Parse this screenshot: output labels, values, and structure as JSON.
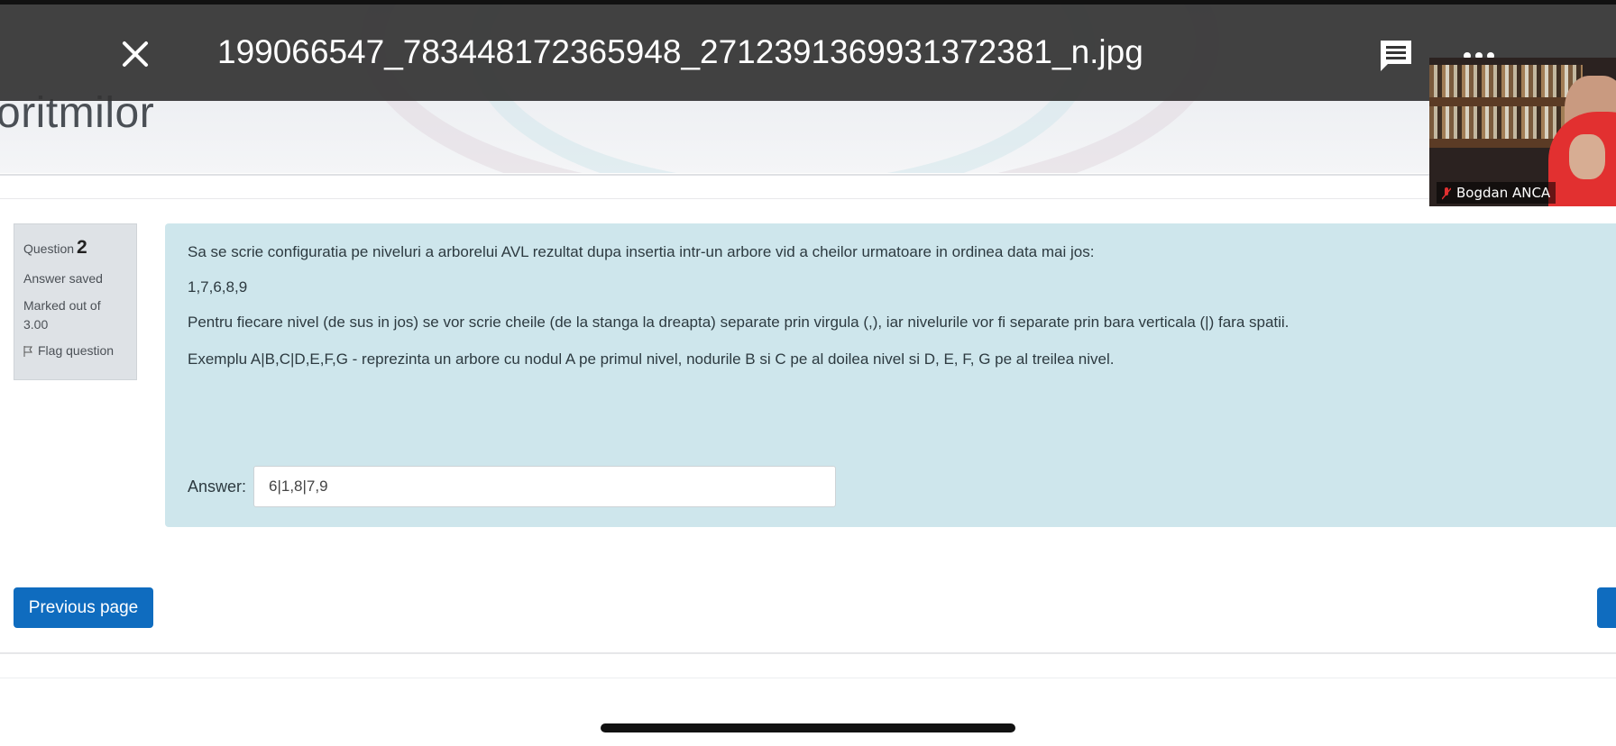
{
  "page": {
    "title_fragment": "oritmilor"
  },
  "viewer": {
    "file_name": "199066547_783448172365948_2712391369931372381_n.jpg",
    "close_icon": "close-icon",
    "comment_icon": "comment-icon",
    "more_icon": "more-icon"
  },
  "video": {
    "participant_name": "Bogdan ANCA"
  },
  "question": {
    "label": "Question",
    "number": "2",
    "state": "Answer saved",
    "marked": "Marked out of 3.00",
    "flag_label": "Flag question",
    "line1": "Sa se scrie configuratia pe niveluri a arborelui AVL rezultat dupa insertia intr-un arbore vid a cheilor urmatoare in ordinea data mai jos:",
    "line2": "1,7,6,8,9",
    "line3": "Pentru fiecare nivel (de sus in jos) se vor scrie cheile (de la stanga la dreapta) separate prin virgula (,), iar nivelurile vor fi separate prin bara verticala (|) fara spatii.",
    "line4": "Exemplu A|B,C|D,E,F,G - reprezinta un arbore cu nodul A pe primul nivel, nodurile B si C pe al doilea nivel si D, E, F, G pe al treilea nivel.",
    "answer_label": "Answer:",
    "answer_value": "6|1,8|7,9"
  },
  "nav": {
    "previous_label": "Previous page"
  },
  "colors": {
    "viewer_bar": "#343434",
    "question_bg": "#cee6ec",
    "button_primary": "#0f6cbf"
  }
}
